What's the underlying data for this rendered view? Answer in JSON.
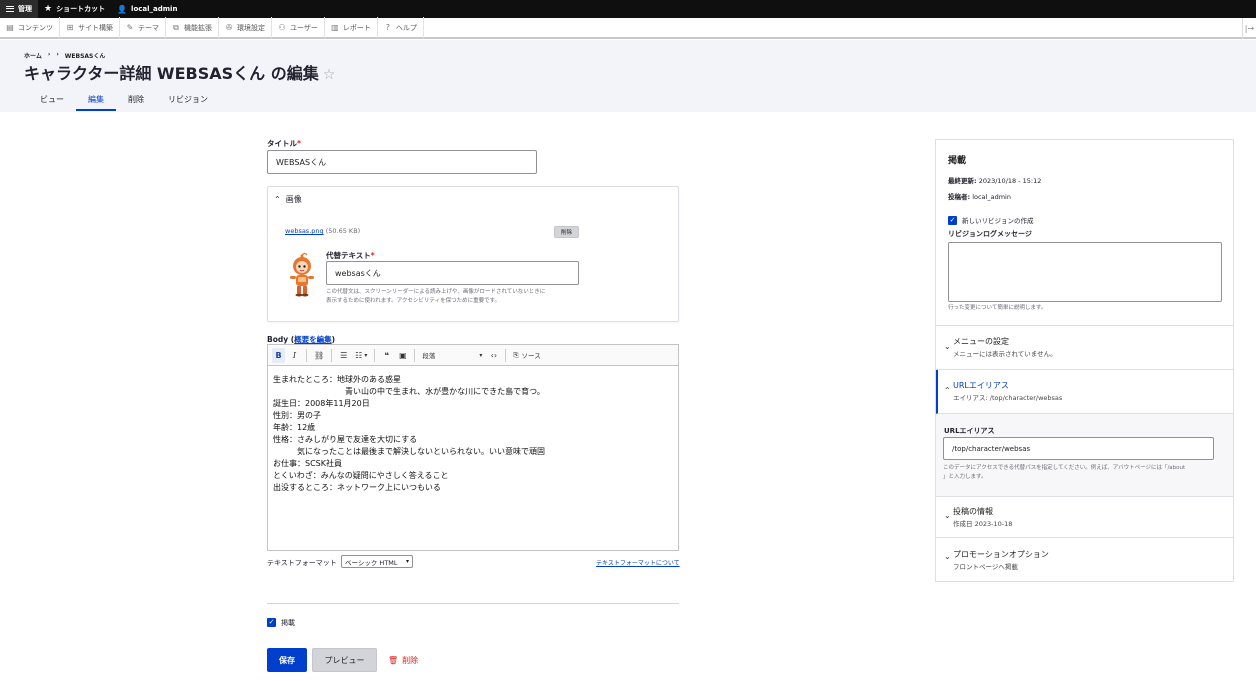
{
  "toolbar": {
    "manage": "管理",
    "shortcuts": "ショートカット",
    "user": "local_admin"
  },
  "tray": {
    "items": [
      {
        "label": "コンテンツ",
        "icon": "file-icon"
      },
      {
        "label": "サイト構築",
        "icon": "sitemap-icon"
      },
      {
        "label": "テーマ",
        "icon": "brush-icon"
      },
      {
        "label": "機能拡張",
        "icon": "puzzle-icon"
      },
      {
        "label": "環境設定",
        "icon": "wrench-icon"
      },
      {
        "label": "ユーザー",
        "icon": "people-icon"
      },
      {
        "label": "レポート",
        "icon": "bar-chart-icon"
      },
      {
        "label": "ヘルプ",
        "icon": "help-icon"
      }
    ]
  },
  "breadcrumb": {
    "home": "ホーム",
    "sep": "›",
    "current": "WEBSASくん"
  },
  "page": {
    "title": "キャラクター詳細 WEBSASくん の編集",
    "star": "☆"
  },
  "tabs": [
    {
      "label": "ビュー"
    },
    {
      "label": "編集"
    },
    {
      "label": "削除"
    },
    {
      "label": "リビジョン"
    }
  ],
  "form": {
    "title_label": "タイトル",
    "required_mark": "*",
    "title_value": "WEBSASくん",
    "image": {
      "section_label": "画像",
      "file_name": "websas.png",
      "file_size": "(50.65 KB)",
      "remove_button": "削除",
      "alt_label": "代替テキスト",
      "alt_value": "websasくん",
      "alt_help_line1": "この代替文は、スクリーンリーダーによる読み上げや、画像がロードされていないときに",
      "alt_help_line2": "表示するために使われます。アクセシビリティを保つために重要です。"
    },
    "body": {
      "label": "Body (",
      "summary_link": "概要を編集",
      "label_close": ")",
      "heading_select": "段落",
      "source_label": "ソース",
      "lines": [
        "生まれたところ：地球外のある惑星",
        "　　　　　　　　　青い山の中で生まれ、水が豊かな川にできた島で育つ。",
        "誕生日：2008年11月20日",
        "性別：男の子",
        "年齢：12歳",
        "性格：さみしがり屋で友達を大切にする",
        "　　　気になったことは最後まで解決しないといられない。いい意味で頑固",
        "お仕事：SCSK社員",
        "とくいわざ：みんなの疑問にやさしく答えること",
        "出没するところ：ネットワーク上にいつもいる"
      ]
    },
    "text_format": {
      "label": "テキストフォーマット",
      "value": "ベーシック HTML",
      "about_link": "テキストフォーマットについて"
    },
    "published_label": "掲載",
    "save_button": "保存",
    "preview_button": "プレビュー",
    "delete_link": "削除"
  },
  "sidebar": {
    "status": {
      "title": "掲載",
      "updated_label": "最終更新:",
      "updated_value": "2023/10/18 - 15:12",
      "author_label": "投稿者:",
      "author_value": "local_admin",
      "new_revision_label": "新しいリビジョンの作成",
      "log_label": "リビジョンログメッセージ",
      "log_help": "行った変更について簡単に説明します。"
    },
    "menu": {
      "title": "メニューの設定",
      "summary": "メニューには表示されていません。"
    },
    "url_alias": {
      "title": "URLエイリアス",
      "summary": "エイリアス: /top/character/websas",
      "field_label": "URLエイリアス",
      "field_value": "/top/character/websas",
      "help_line1": "このデータにアクセスできる代替パスを指定してください。例えば、アバウトページには「/about",
      "help_line2": "」と入力します。"
    },
    "authoring": {
      "title": "投稿の情報",
      "summary": "作成日 2023-10-18"
    },
    "promotion": {
      "title": "プロモーションオプション",
      "summary": "フロントページへ掲載"
    }
  },
  "colors": {
    "accent": "#003ecc",
    "danger": "#d72222",
    "header_bg": "#f3f4f9",
    "topbar_bg": "#0f0f0f"
  }
}
